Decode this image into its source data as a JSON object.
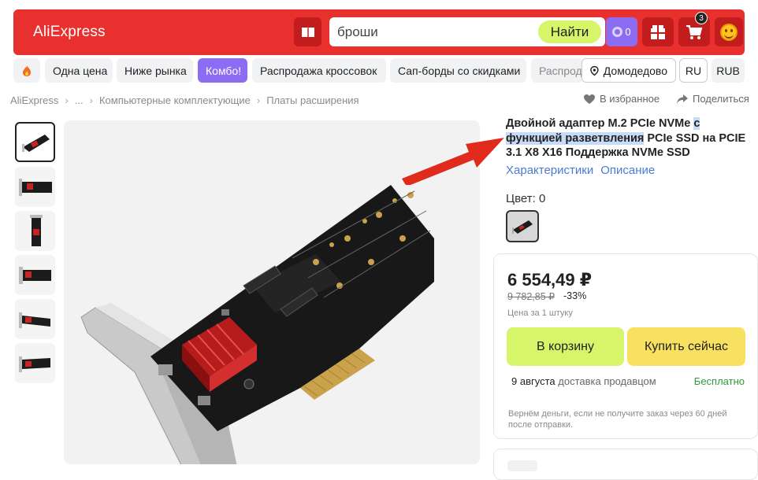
{
  "header": {
    "logo": "AliExpress",
    "search_value": "броши",
    "search_button": "Найти",
    "coins_count": "0",
    "cart_badge": "3",
    "brand_color": "#e8302f"
  },
  "chips": [
    {
      "label": ""
    },
    {
      "label": "Одна цена"
    },
    {
      "label": "Ниже рынка"
    },
    {
      "label": "Комбо!"
    },
    {
      "label": "Распродажа кроссовок"
    },
    {
      "label": "Сап-борды со скидками"
    },
    {
      "label": "Распрод"
    },
    {
      "label": "Домодедово"
    },
    {
      "label": "RU"
    },
    {
      "label": "RUB"
    }
  ],
  "breadcrumb": {
    "items": [
      "AliExpress",
      "...",
      "Компьютерные комплектующие",
      "Платы расширения"
    ],
    "favorite": "В избранное",
    "share": "Поделиться"
  },
  "product": {
    "title_part1": "Двойной адаптер M.2 PCIe NVMe ",
    "title_highlight": "с функцией разветвления",
    "title_part2": " PCIe SSD на PCIE 3.1 X8 X16 Поддержка NVMe SSD",
    "link_specs": "Характеристики",
    "link_description": "Описание",
    "color_label": "Цвет: 0"
  },
  "price_card": {
    "price": "6 554,49 ₽",
    "old_price": "9 782,85 ₽",
    "discount": "-33%",
    "unit": "Цена за 1 штуку",
    "add_to_cart": "В корзину",
    "buy_now": "Купить сейчас",
    "delivery_date": "9 августа",
    "delivery_method": "доставка продавцом",
    "delivery_price": "Бесплатно",
    "refund": "Вернём деньги, если не получите заказ через 60 дней после отправки."
  }
}
